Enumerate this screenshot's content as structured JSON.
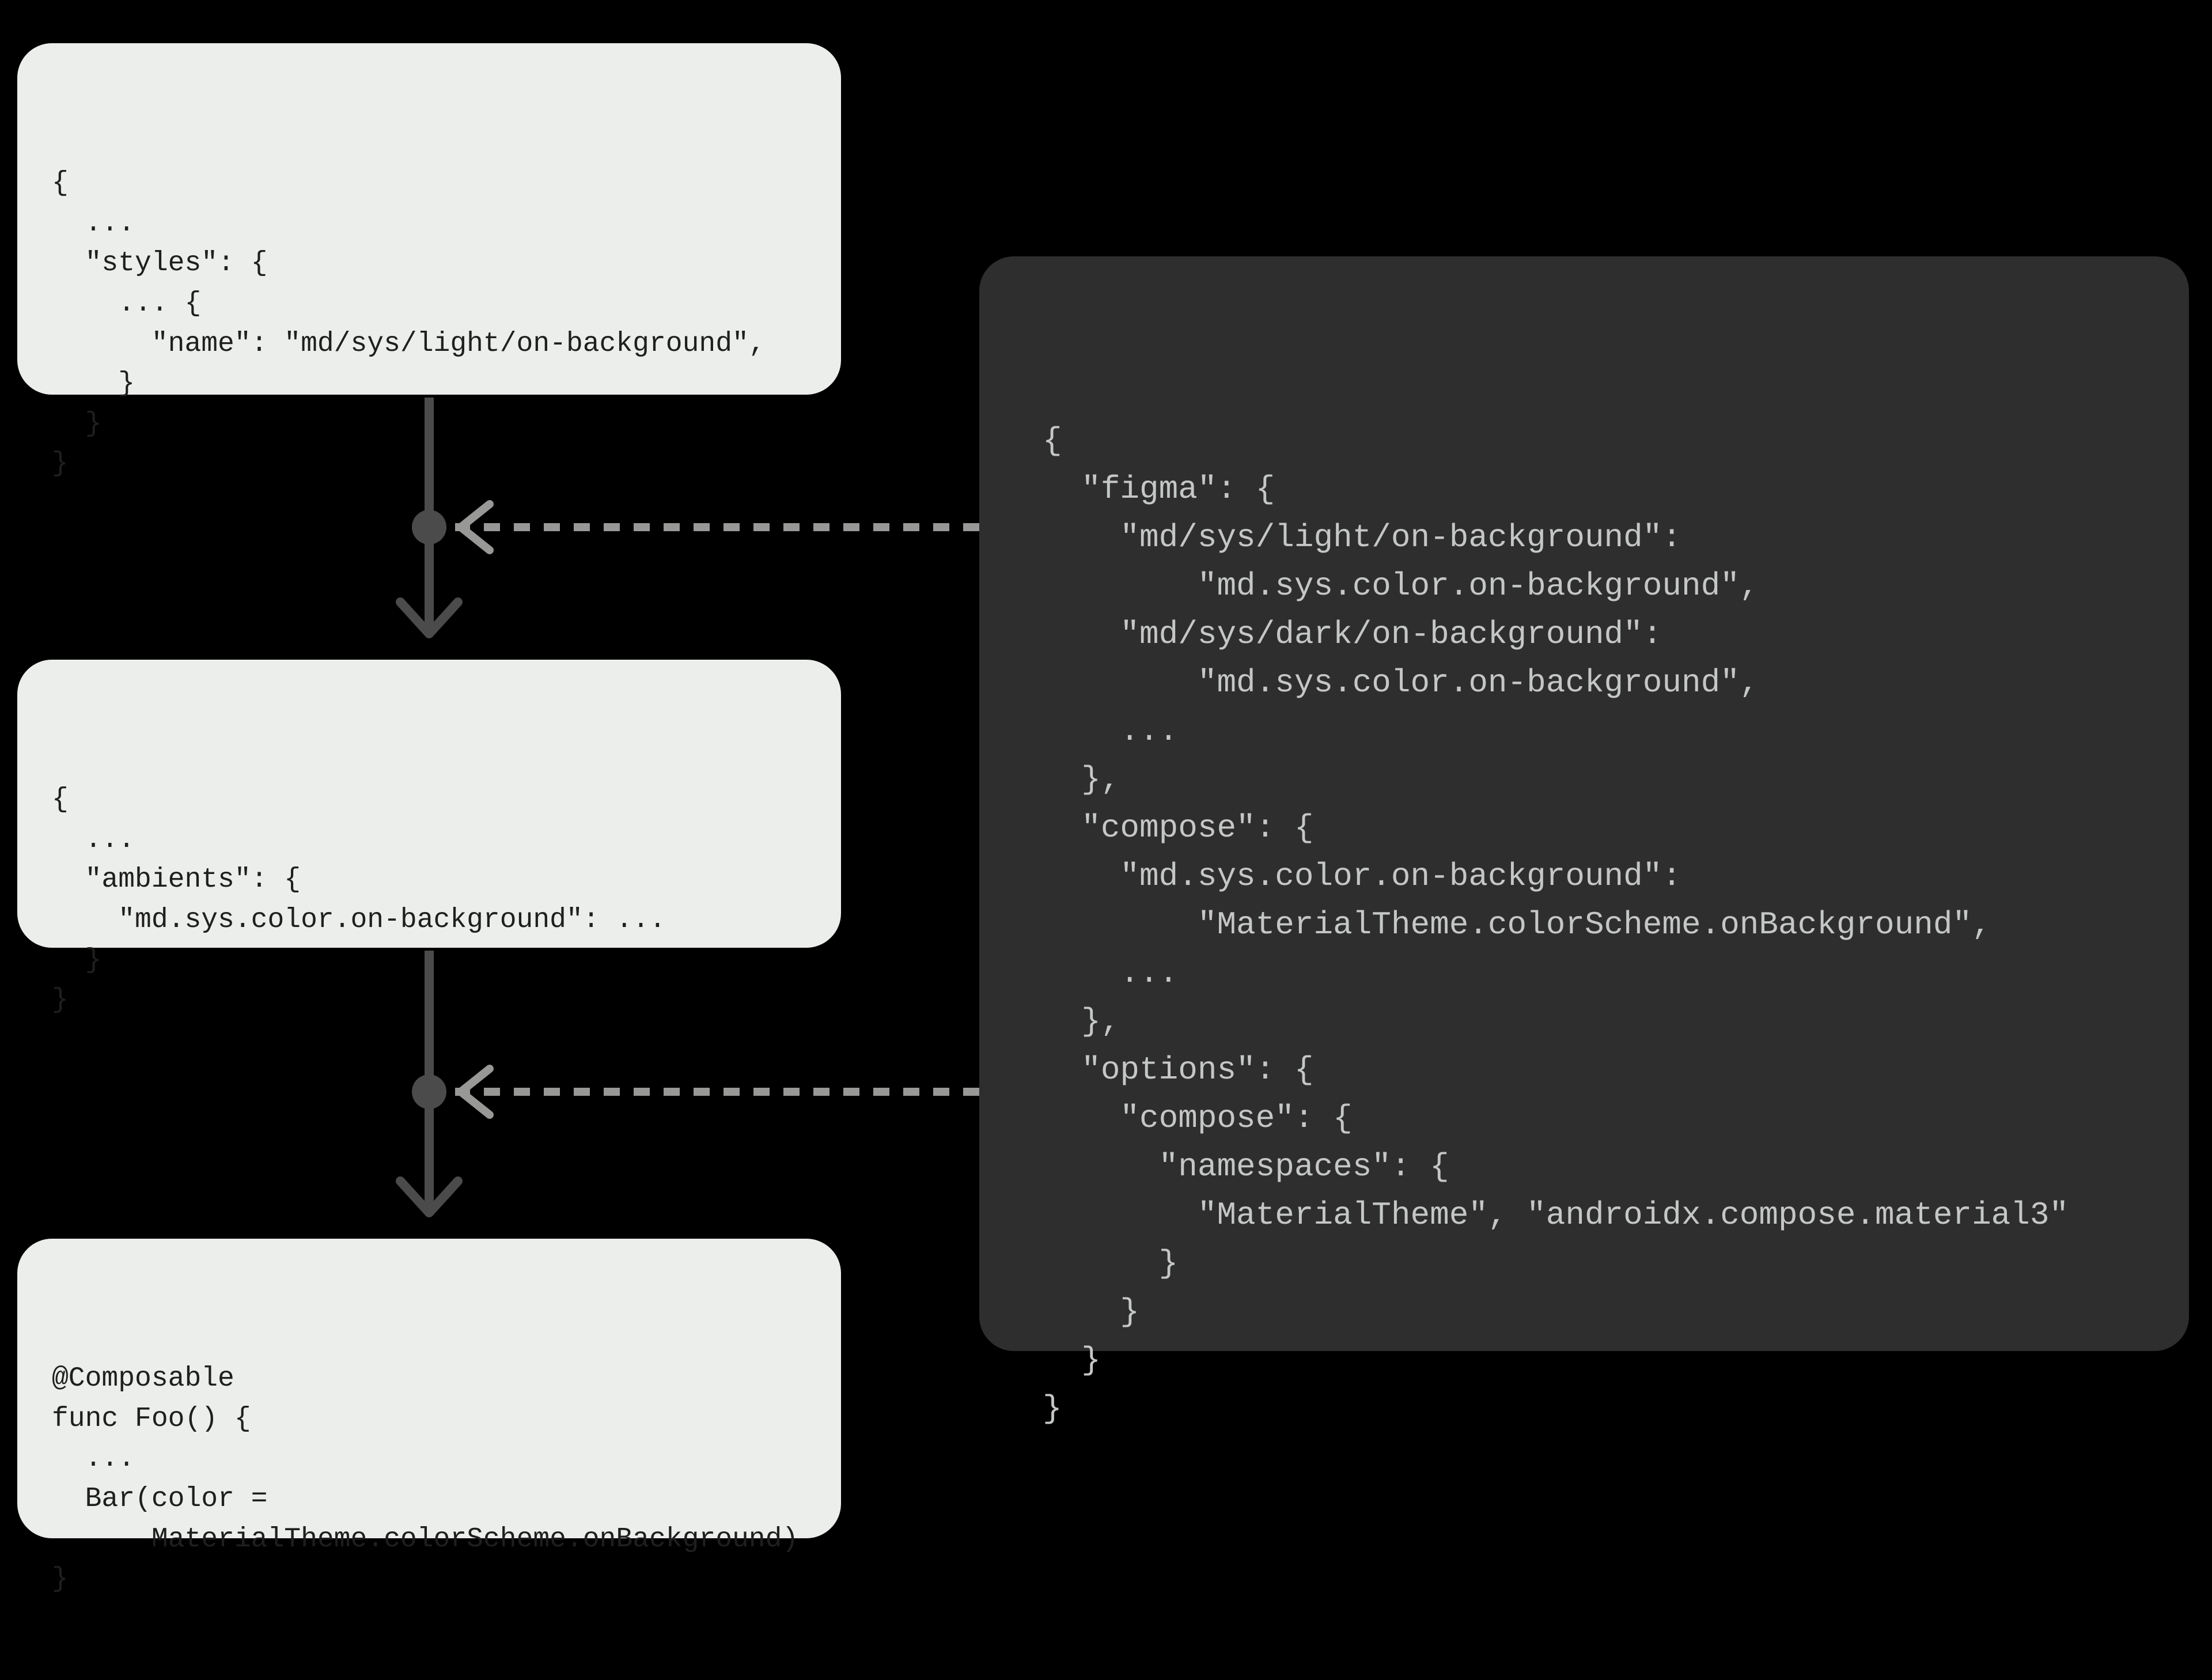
{
  "colors": {
    "light_card_bg": "#eceeeb",
    "light_card_text": "#1e1f1e",
    "dark_card_bg": "#2e2e2e",
    "dark_card_text": "#c4c7c5",
    "connector": "#989897",
    "connector_dark": "#4b4b4b"
  },
  "cards": {
    "top": {
      "code": "{\n  ...\n  \"styles\": {\n    ... {\n      \"name\": \"md/sys/light/on-background\",\n    }\n  }\n}"
    },
    "middle": {
      "code": "{\n  ...\n  \"ambients\": {\n    \"md.sys.color.on-background\": ...\n  }\n}"
    },
    "bottom": {
      "code": "@Composable\nfunc Foo() {\n  ...\n  Bar(color =\n      MaterialTheme.colorScheme.onBackground)\n}"
    },
    "config": {
      "code": "{\n  \"figma\": {\n    \"md/sys/light/on-background\":\n        \"md.sys.color.on-background\",\n    \"md/sys/dark/on-background\":\n        \"md.sys.color.on-background\",\n    ...\n  },\n  \"compose\": {\n    \"md.sys.color.on-background\":\n        \"MaterialTheme.colorScheme.onBackground\",\n    ...\n  },\n  \"options\": {\n    \"compose\": {\n      \"namespaces\": {\n        \"MaterialTheme\", \"androidx.compose.material3\"\n      }\n    }\n  }\n}"
    }
  }
}
